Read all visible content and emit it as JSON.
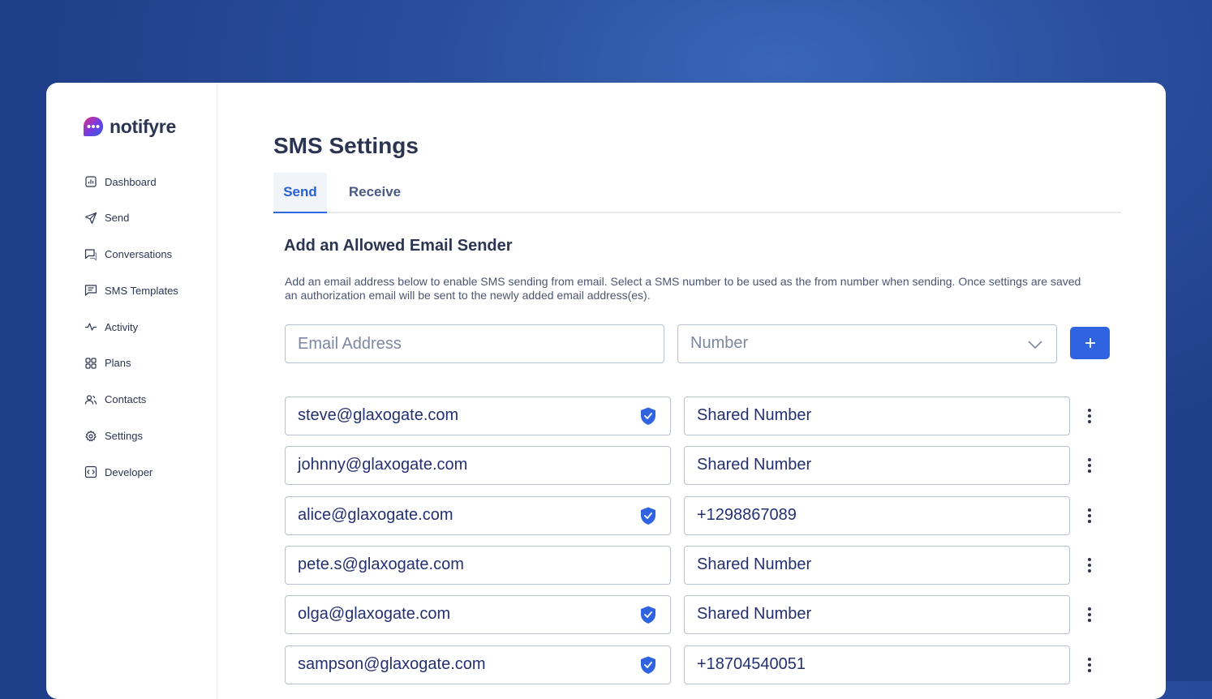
{
  "brand": {
    "name": "notifyre"
  },
  "nav": [
    {
      "label": "Dashboard",
      "icon": "dashboard-icon"
    },
    {
      "label": "Send",
      "icon": "send-icon"
    },
    {
      "label": "Conversations",
      "icon": "conversations-icon"
    },
    {
      "label": "SMS Templates",
      "icon": "sms-templates-icon"
    },
    {
      "label": "Activity",
      "icon": "activity-icon"
    },
    {
      "label": "Plans",
      "icon": "plans-icon"
    },
    {
      "label": "Contacts",
      "icon": "contacts-icon"
    },
    {
      "label": "Settings",
      "icon": "settings-icon"
    },
    {
      "label": "Developer",
      "icon": "developer-icon"
    }
  ],
  "page": {
    "title": "SMS Settings"
  },
  "tabs": [
    {
      "label": "Send",
      "active": true
    },
    {
      "label": "Receive",
      "active": false
    }
  ],
  "section": {
    "title": "Add an Allowed Email Sender",
    "description": "Add an email address below to enable SMS sending from email. Select a SMS number to be used as the from number when sending. Once settings are saved an authorization email will be sent to the newly added email address(es)."
  },
  "form": {
    "email_placeholder": "Email Address",
    "number_placeholder": "Number",
    "add_label": "+"
  },
  "senders": [
    {
      "email": "steve@glaxogate.com",
      "number": "Shared Number",
      "verified": true
    },
    {
      "email": "johnny@glaxogate.com",
      "number": "Shared Number",
      "verified": false
    },
    {
      "email": "alice@glaxogate.com",
      "number": "+1298867089",
      "verified": true
    },
    {
      "email": "pete.s@glaxogate.com",
      "number": "Shared Number",
      "verified": false
    },
    {
      "email": "olga@glaxogate.com",
      "number": "Shared Number",
      "verified": true
    },
    {
      "email": "sampson@glaxogate.com",
      "number": "+18704540051",
      "verified": true
    }
  ],
  "colors": {
    "accent": "#2f63e0",
    "text": "#2b3551",
    "value_text": "#243070",
    "border": "#b8bfcf",
    "background": "#2a4f9e"
  }
}
